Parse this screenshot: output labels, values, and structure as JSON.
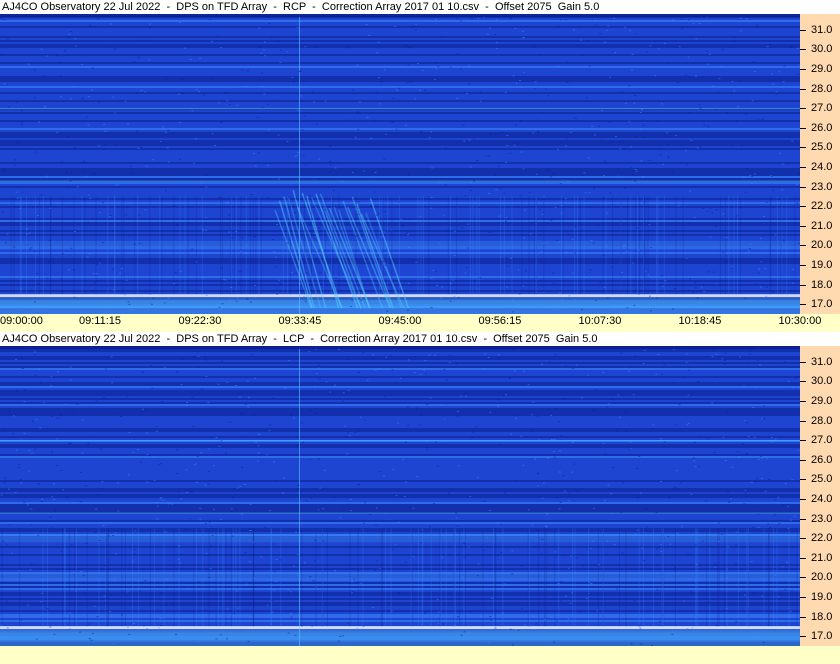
{
  "panels": [
    {
      "title": "AJ4CO Observatory 22 Jul 2022  -  DPS on TFD Array  -  RCP  -  Correction Array 2017 01 10.csv  -  Offset 2075  Gain 5.0",
      "polarization": "RCP",
      "y_ticks": [
        "31.0",
        "30.0",
        "29.0",
        "28.0",
        "27.0",
        "26.0",
        "25.0",
        "24.0",
        "23.0",
        "22.0",
        "21.0",
        "20.0",
        "19.0",
        "18.0",
        "17.0"
      ],
      "x_ticks": [
        "09:00:00",
        "09:11:15",
        "09:22:30",
        "09:33:45",
        "09:45:00",
        "09:56:15",
        "10:07:30",
        "10:18:45",
        "10:30:00"
      ]
    },
    {
      "title": "AJ4CO Observatory 22 Jul 2022  -  DPS on TFD Array  -  LCP  -  Correction Array 2017 01 10.csv  -  Offset 2075  Gain 5.0",
      "polarization": "LCP",
      "y_ticks": [
        "31.0",
        "30.0",
        "29.0",
        "28.0",
        "27.0",
        "26.0",
        "25.0",
        "24.0",
        "23.0",
        "22.0",
        "21.0",
        "20.0",
        "19.0",
        "18.0",
        "17.0"
      ],
      "x_ticks": []
    }
  ],
  "chart_data": [
    {
      "type": "heatmap",
      "title": "AJ4CO Observatory 22 Jul 2022  -  DPS on TFD Array  -  RCP  -  Correction Array 2017 01 10.csv  -  Offset 2075  Gain 5.0",
      "xlabel": "",
      "ylabel": "",
      "x_range": [
        "09:00:00",
        "10:30:00"
      ],
      "y_range": [
        16.5,
        31.8
      ],
      "x_ticks": [
        "09:00:00",
        "09:11:15",
        "09:22:30",
        "09:33:45",
        "09:45:00",
        "09:56:15",
        "10:07:30",
        "10:18:45",
        "10:30:00"
      ],
      "y_ticks": [
        31,
        30,
        29,
        28,
        27,
        26,
        25,
        24,
        23,
        22,
        21,
        20,
        19,
        18,
        17
      ],
      "colormap": [
        "#0a1e8c",
        "#1e46d2",
        "#3c8cff",
        "#5ad2ff"
      ],
      "bright_bands_mhz": [
        20.0,
        17.0
      ],
      "burst_time_range": [
        "09:33:45",
        "09:45:00"
      ]
    },
    {
      "type": "heatmap",
      "title": "AJ4CO Observatory 22 Jul 2022  -  DPS on TFD Array  -  LCP  -  Correction Array 2017 01 10.csv  -  Offset 2075  Gain 5.0",
      "xlabel": "",
      "ylabel": "",
      "x_range": [
        "09:00:00",
        "10:30:00"
      ],
      "y_range": [
        16.5,
        31.8
      ],
      "x_ticks": [],
      "y_ticks": [
        31,
        30,
        29,
        28,
        27,
        26,
        25,
        24,
        23,
        22,
        21,
        20,
        19,
        18,
        17
      ],
      "colormap": [
        "#0a1e8c",
        "#1e46d2",
        "#3c8cff",
        "#5ad2ff"
      ],
      "bright_bands_mhz": [
        22.0,
        20.0,
        17.0
      ]
    }
  ]
}
